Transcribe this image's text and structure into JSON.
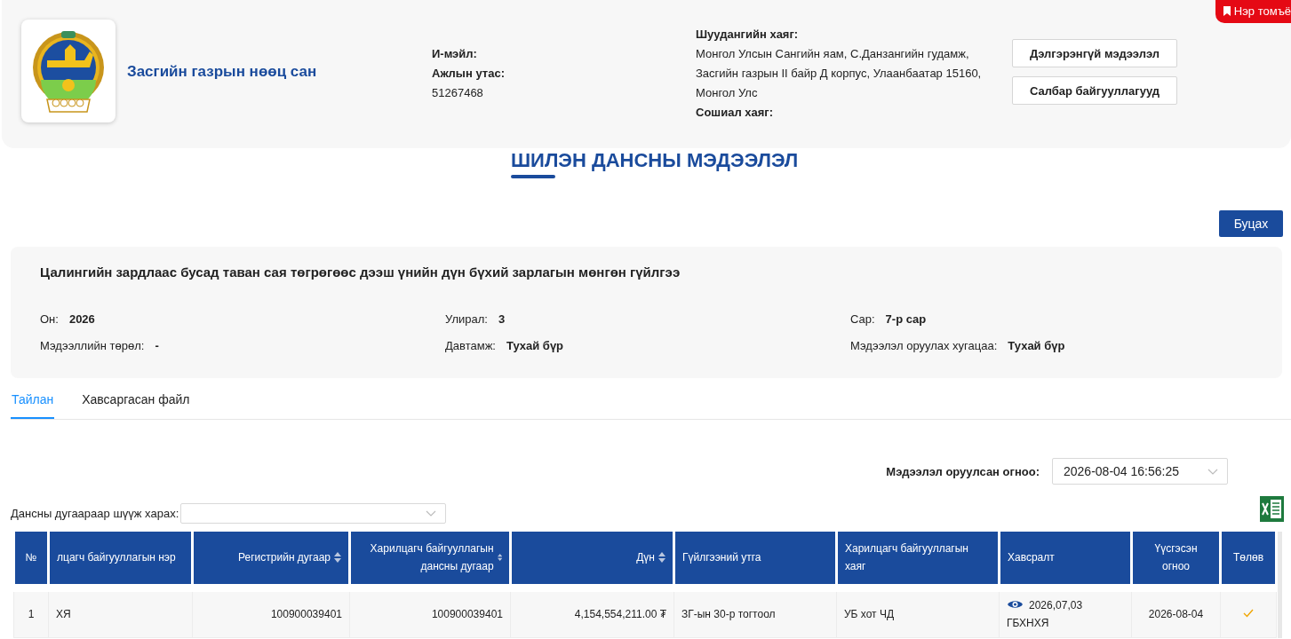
{
  "bookmark_tab": {
    "label": "Нэр томъё"
  },
  "organization": {
    "name": "Засгийн газрын нөөц сан",
    "email_label": "И-мэйл:",
    "phone_label": "Ажлын утас:",
    "phone": "51267468",
    "address_label": "Шуудангийн хаяг:",
    "address": "Монгол Улсын Сангийн яам, С.Данзангийн гудамж, Засгийн газрын II байр Д корпус, Улаанбаатар 15160, Монгол Улс",
    "social_label": "Сошиал хаяг:",
    "buttons": [
      "Дэлгэрэнгүй мэдээлэл",
      "Салбар байгууллагууд"
    ]
  },
  "page_title": "ШИЛЭН ДАНСНЫ МЭДЭЭЛЭЛ",
  "back_button": "Буцах",
  "report": {
    "title": "Цалингийн зардлаас бусад таван сая төгрөгөөс дээш үнийн дүн бүхий зарлагын мөнгөн гүйлгээ",
    "fields": [
      {
        "label": "Он:",
        "value": "2026"
      },
      {
        "label": "Улирал:",
        "value": "3"
      },
      {
        "label": "Сар:",
        "value": "7-р сар"
      },
      {
        "label": "Мэдээллийн төрөл:",
        "value": "-"
      },
      {
        "label": "Давтамж:",
        "value": "Тухай бүр"
      },
      {
        "label": "Мэдээлэл оруулах хугацаа:",
        "value": "Тухай бүр"
      }
    ]
  },
  "tabs": [
    {
      "label": "Тайлан",
      "selected": true
    },
    {
      "label": "Хавсаргасан файл",
      "selected": false
    }
  ],
  "submitted_date": {
    "label": "Мэдээлэл оруулсан огноо:",
    "value": "2026-08-04 16:56:25"
  },
  "account_filter": {
    "label": "Дансны дугаараар шүүж харах:"
  },
  "table": {
    "columns": [
      {
        "label": "№",
        "sortable": false
      },
      {
        "label": "лцагч байгууллагын нэр",
        "sortable": false
      },
      {
        "label": "Регистрийн дугаар",
        "sortable": true
      },
      {
        "label": "Харилцагч байгууллагын дансны дугаар",
        "sortable": true
      },
      {
        "label": "Дүн",
        "sortable": true
      },
      {
        "label": "Гүйлгээний утга",
        "sortable": false
      },
      {
        "label": "Харилцагч байгууллагын хаяг",
        "sortable": false
      },
      {
        "label": "Хавсралт",
        "sortable": false
      },
      {
        "label": "Үүсгэсэн огноо",
        "sortable": false
      },
      {
        "label": "Төлөв",
        "sortable": false
      }
    ],
    "rows": [
      {
        "cells": [
          "1",
          "ХЯ",
          "100900039401",
          "100900039401",
          "4,154,554,211.00 ₮",
          "ЗГ-ын 30-р тогтоол",
          "УБ хот ЧД",
          "2026,07,03 ГБХНХЯ",
          "2026-08-04"
        ],
        "paid": true
      }
    ]
  }
}
